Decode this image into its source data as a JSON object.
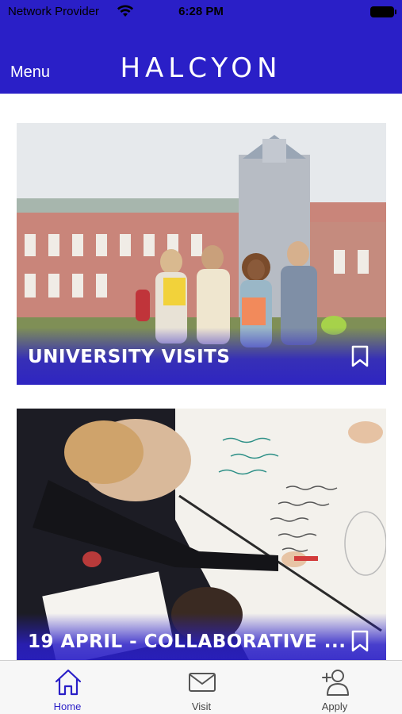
{
  "status": {
    "carrier": "Network Provider",
    "time": "6:28 PM"
  },
  "header": {
    "menu_label": "Menu",
    "brand": "HALCYON"
  },
  "cards": [
    {
      "title": "UNIVERSITY VISITS"
    },
    {
      "title": "19 APRIL - COLLABORATIVE ..."
    }
  ],
  "tabs": [
    {
      "label": "Home",
      "icon": "home-icon",
      "active": true
    },
    {
      "label": "Visit",
      "icon": "mail-icon",
      "active": false
    },
    {
      "label": "Apply",
      "icon": "add-person-icon",
      "active": false
    }
  ],
  "colors": {
    "brand": "#2a1fc7",
    "tab_active": "#2a1fc7",
    "tab_inactive": "#444444"
  }
}
